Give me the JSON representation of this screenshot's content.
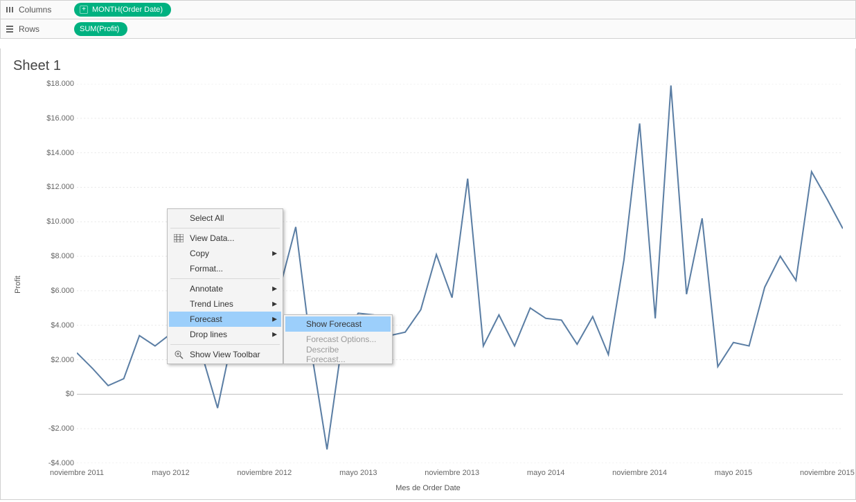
{
  "shelves": {
    "columns_label": "Columns",
    "rows_label": "Rows",
    "columns_pill": "MONTH(Order Date)",
    "rows_pill": "SUM(Profit)"
  },
  "sheet": {
    "title": "Sheet 1"
  },
  "context_menu": {
    "select_all": "Select All",
    "view_data": "View Data...",
    "copy": "Copy",
    "format": "Format...",
    "annotate": "Annotate",
    "trend_lines": "Trend Lines",
    "forecast": "Forecast",
    "drop_lines": "Drop lines",
    "show_view_toolbar": "Show View Toolbar",
    "submenu": {
      "show_forecast": "Show Forecast",
      "forecast_options": "Forecast Options...",
      "describe_forecast": "Describe Forecast..."
    }
  },
  "chart_data": {
    "type": "line",
    "title": "",
    "ylabel": "Profit",
    "xlabel": "Mes de Order Date",
    "ylim": [
      -4000,
      18000
    ],
    "y_ticks": [
      -4000,
      -2000,
      0,
      2000,
      4000,
      6000,
      8000,
      10000,
      12000,
      14000,
      16000,
      18000
    ],
    "y_tick_labels": [
      "-$4.000",
      "-$2.000",
      "$0",
      "$2.000",
      "$4.000",
      "$6.000",
      "$8.000",
      "$10.000",
      "$12.000",
      "$14.000",
      "$16.000",
      "$18.000"
    ],
    "x_tick_labels": [
      "noviembre 2011",
      "mayo 2012",
      "noviembre 2012",
      "mayo 2013",
      "noviembre 2013",
      "mayo 2014",
      "noviembre 2014",
      "mayo 2015",
      "noviembre 2015"
    ],
    "x_tick_indices": [
      0,
      6,
      12,
      18,
      24,
      30,
      36,
      42,
      48
    ],
    "categories": [
      "2011-11",
      "2011-12",
      "2012-01",
      "2012-02",
      "2012-03",
      "2012-04",
      "2012-05",
      "2012-06",
      "2012-07",
      "2012-08",
      "2012-09",
      "2012-10",
      "2012-11",
      "2012-12",
      "2013-01",
      "2013-02",
      "2013-03",
      "2013-04",
      "2013-05",
      "2013-06",
      "2013-07",
      "2013-08",
      "2013-09",
      "2013-10",
      "2013-11",
      "2013-12",
      "2014-01",
      "2014-02",
      "2014-03",
      "2014-04",
      "2014-05",
      "2014-06",
      "2014-07",
      "2014-08",
      "2014-09",
      "2014-10",
      "2014-11",
      "2014-12",
      "2015-01",
      "2015-02",
      "2015-03",
      "2015-04",
      "2015-05",
      "2015-06",
      "2015-07",
      "2015-08",
      "2015-09",
      "2015-10",
      "2015-11",
      "2015-12"
    ],
    "values": [
      2400,
      1500,
      500,
      900,
      3400,
      2800,
      3500,
      5000,
      2300,
      -800,
      3500,
      5600,
      9000,
      6200,
      9700,
      2500,
      -3200,
      3200,
      4700,
      4600,
      3400,
      3600,
      4900,
      8100,
      5600,
      12500,
      2800,
      4600,
      2800,
      5000,
      4400,
      4300,
      2900,
      4500,
      2300,
      7800,
      15700,
      4400,
      17900,
      5800,
      10200,
      1600,
      3000,
      2800,
      6200,
      8000,
      6600,
      12900,
      11300,
      9600
    ]
  }
}
